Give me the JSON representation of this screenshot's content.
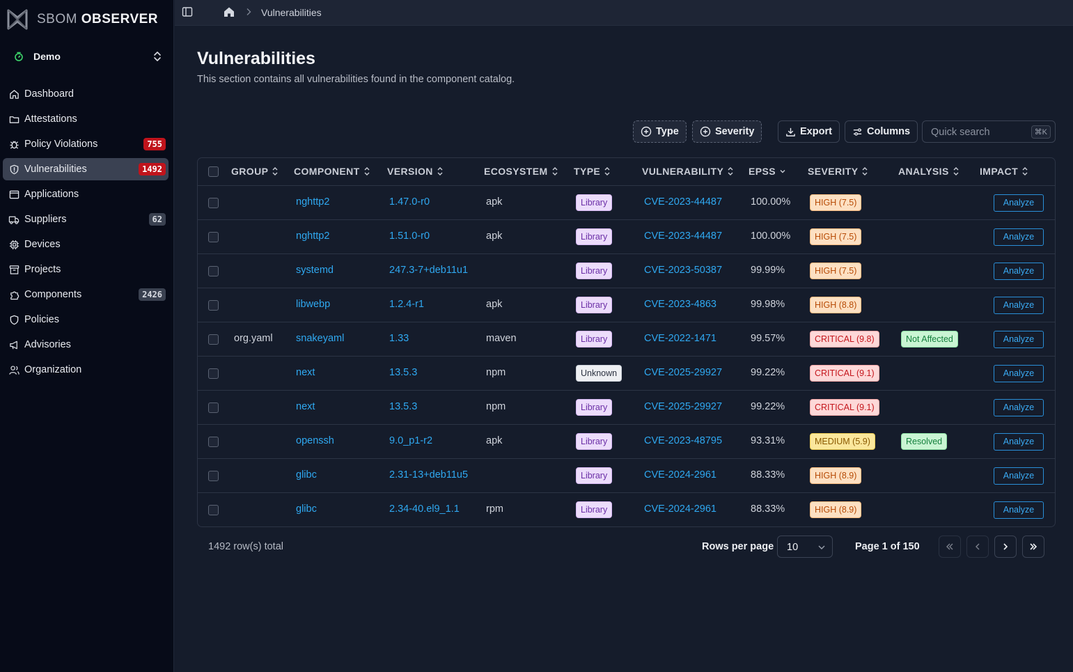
{
  "app": {
    "logo_bold": "SBOM",
    "logo_light": "OBSERVER"
  },
  "org": {
    "name": "Demo"
  },
  "sidebar": {
    "items": [
      {
        "label": "Dashboard",
        "icon": "home-icon"
      },
      {
        "label": "Attestations",
        "icon": "folder-icon"
      },
      {
        "label": "Policy Violations",
        "icon": "bug-icon",
        "badge": "755"
      },
      {
        "label": "Vulnerabilities",
        "icon": "shield-icon",
        "badge": "1492",
        "active": true
      },
      {
        "label": "Applications",
        "icon": "window-icon"
      },
      {
        "label": "Suppliers",
        "icon": "truck-icon",
        "badge": "62"
      },
      {
        "label": "Devices",
        "icon": "chip-icon"
      },
      {
        "label": "Projects",
        "icon": "archive-icon"
      },
      {
        "label": "Components",
        "icon": "puzzle-icon",
        "badge": "2426"
      },
      {
        "label": "Policies",
        "icon": "shield-check-icon"
      },
      {
        "label": "Advisories",
        "icon": "megaphone-icon"
      },
      {
        "label": "Organization",
        "icon": "users-icon"
      }
    ]
  },
  "breadcrumb": {
    "current": "Vulnerabilities"
  },
  "page": {
    "title": "Vulnerabilities",
    "subtitle": "This section contains all vulnerabilities found in the component catalog."
  },
  "toolbar": {
    "type_label": "Type",
    "severity_label": "Severity",
    "export_label": "Export",
    "columns_label": "Columns",
    "search_placeholder": "Quick search",
    "search_shortcut": "⌘K"
  },
  "table": {
    "columns": [
      "GROUP",
      "COMPONENT",
      "VERSION",
      "ECOSYSTEM",
      "TYPE",
      "VULNERABILITY",
      "EPSS",
      "SEVERITY",
      "ANALYSIS",
      "IMPACT"
    ],
    "action_label": "Analyze",
    "rows": [
      {
        "group": "",
        "component": "nghttp2",
        "version": "1.47.0-r0",
        "ecosystem": "apk",
        "type": "Library",
        "vulnerability": "CVE-2023-44487",
        "epss": "100.00%",
        "severity": "HIGH (7.5)",
        "sev_level": "high",
        "analysis": ""
      },
      {
        "group": "",
        "component": "nghttp2",
        "version": "1.51.0-r0",
        "ecosystem": "apk",
        "type": "Library",
        "vulnerability": "CVE-2023-44487",
        "epss": "100.00%",
        "severity": "HIGH (7.5)",
        "sev_level": "high",
        "analysis": ""
      },
      {
        "group": "",
        "component": "systemd",
        "version": "247.3-7+deb11u1",
        "ecosystem": "",
        "type": "Library",
        "vulnerability": "CVE-2023-50387",
        "epss": "99.99%",
        "severity": "HIGH (7.5)",
        "sev_level": "high",
        "analysis": ""
      },
      {
        "group": "",
        "component": "libwebp",
        "version": "1.2.4-r1",
        "ecosystem": "apk",
        "type": "Library",
        "vulnerability": "CVE-2023-4863",
        "epss": "99.98%",
        "severity": "HIGH (8.8)",
        "sev_level": "high",
        "analysis": ""
      },
      {
        "group": "org.yaml",
        "component": "snakeyaml",
        "version": "1.33",
        "ecosystem": "maven",
        "type": "Library",
        "vulnerability": "CVE-2022-1471",
        "epss": "99.57%",
        "severity": "CRITICAL (9.8)",
        "sev_level": "critical",
        "analysis": "Not Affected"
      },
      {
        "group": "",
        "component": "next",
        "version": "13.5.3",
        "ecosystem": "npm",
        "type": "Unknown",
        "vulnerability": "CVE-2025-29927",
        "epss": "99.22%",
        "severity": "CRITICAL (9.1)",
        "sev_level": "critical",
        "analysis": ""
      },
      {
        "group": "",
        "component": "next",
        "version": "13.5.3",
        "ecosystem": "npm",
        "type": "Library",
        "vulnerability": "CVE-2025-29927",
        "epss": "99.22%",
        "severity": "CRITICAL (9.1)",
        "sev_level": "critical",
        "analysis": ""
      },
      {
        "group": "",
        "component": "openssh",
        "version": "9.0_p1-r2",
        "ecosystem": "apk",
        "type": "Library",
        "vulnerability": "CVE-2023-48795",
        "epss": "93.31%",
        "severity": "MEDIUM (5.9)",
        "sev_level": "medium",
        "analysis": "Resolved"
      },
      {
        "group": "",
        "component": "glibc",
        "version": "2.31-13+deb11u5",
        "ecosystem": "",
        "type": "Library",
        "vulnerability": "CVE-2024-2961",
        "epss": "88.33%",
        "severity": "HIGH (8.9)",
        "sev_level": "high",
        "analysis": ""
      },
      {
        "group": "",
        "component": "glibc",
        "version": "2.34-40.el9_1.1",
        "ecosystem": "rpm",
        "type": "Library",
        "vulnerability": "CVE-2024-2961",
        "epss": "88.33%",
        "severity": "HIGH (8.9)",
        "sev_level": "high",
        "analysis": ""
      }
    ]
  },
  "footer": {
    "total": "1492 row(s) total",
    "rows_per_page_label": "Rows per page",
    "rows_per_page_value": "10",
    "page_info": "Page 1 of 150"
  }
}
